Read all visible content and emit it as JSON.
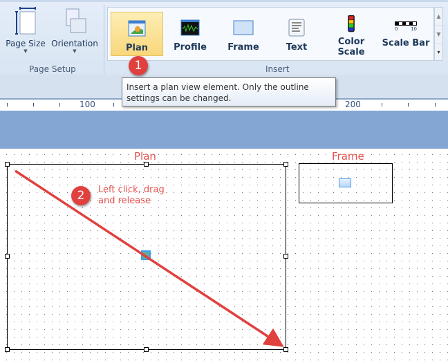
{
  "ribbon": {
    "page_setup": {
      "group_label": "Page Setup",
      "page_size": "Page Size",
      "orientation": "Orientation"
    },
    "insert": {
      "group_label": "Insert",
      "items": [
        "Plan",
        "Profile",
        "Frame",
        "Text",
        "Color Scale",
        "Scale Bar"
      ],
      "scale_bar_ticks": [
        "0",
        "10"
      ]
    }
  },
  "tooltip": {
    "text": "Insert a plan view element. Only the outline settings can be changed."
  },
  "ruler": {
    "labels": [
      "100",
      "200"
    ]
  },
  "canvas": {
    "plan_label": "Plan",
    "frame_label": "Frame"
  },
  "annotations": {
    "step1": "1",
    "step2": "2",
    "step2_text_line1": "Left click, drag",
    "step2_text_line2": "and release",
    "color": "#e0413f"
  }
}
